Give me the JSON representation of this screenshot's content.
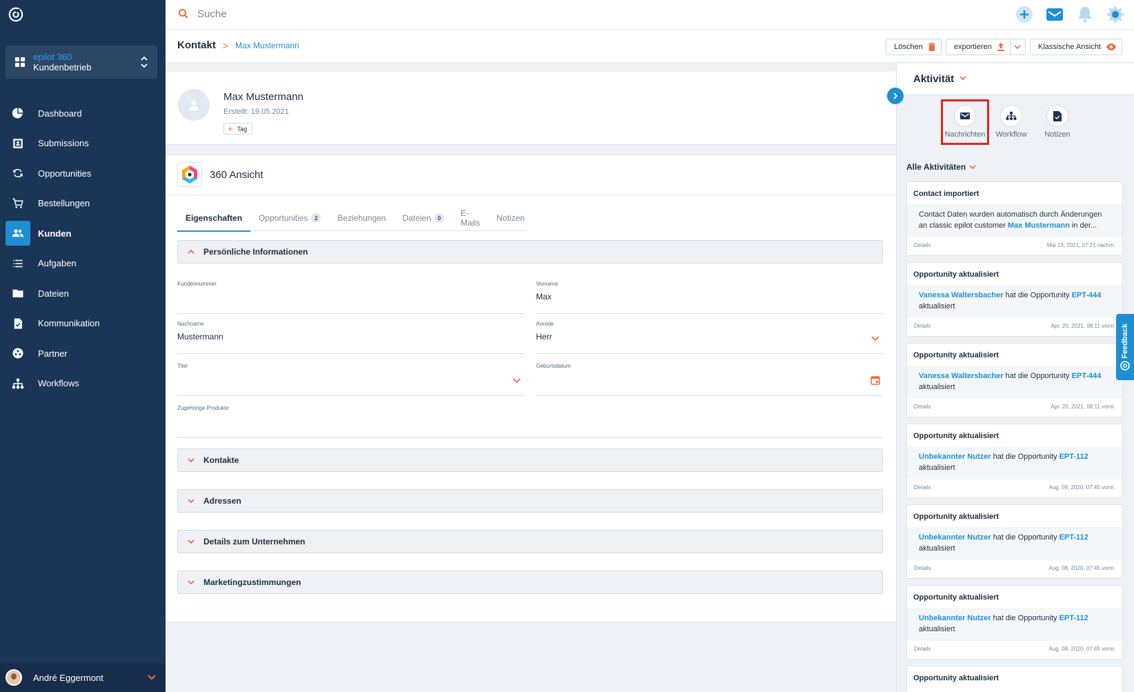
{
  "sidebar": {
    "org_name": "epilot 360",
    "org_sub": "Kundenbetrieb",
    "items": [
      {
        "label": "Dashboard",
        "icon": "dashboard-icon"
      },
      {
        "label": "Submissions",
        "icon": "submissions-icon"
      },
      {
        "label": "Opportunities",
        "icon": "opportunities-icon"
      },
      {
        "label": "Bestellungen",
        "icon": "cart-icon"
      },
      {
        "label": "Kunden",
        "icon": "people-icon",
        "active": true
      },
      {
        "label": "Aufgaben",
        "icon": "list-icon"
      },
      {
        "label": "Dateien",
        "icon": "folder-icon"
      },
      {
        "label": "Kommunikation",
        "icon": "document-check-icon"
      },
      {
        "label": "Partner",
        "icon": "partner-icon"
      },
      {
        "label": "Workflows",
        "icon": "workflow-icon"
      }
    ],
    "user_name": "André Eggermont"
  },
  "topbar": {
    "search_placeholder": "Suche"
  },
  "header": {
    "crumb_root": "Kontakt",
    "crumb_sep": ">",
    "crumb_current": "Max Mustermann",
    "delete_label": "Löschen",
    "export_label": "exportieren",
    "classic_label": "Klassische Ansicht"
  },
  "profile": {
    "name": "Max Mustermann",
    "created": "Erstellt: 19.05.2021",
    "tag_label": "Tag"
  },
  "view": {
    "title": "360 Ansicht",
    "tabs": [
      {
        "label": "Eigenschaften"
      },
      {
        "label": "Opportunities",
        "count": "2"
      },
      {
        "label": "Beziehungen"
      },
      {
        "label": "Dateien",
        "count": "0"
      },
      {
        "label": "E-Mails"
      },
      {
        "label": "Notizen"
      }
    ],
    "sections": {
      "personal": "Persönliche Informationen",
      "contacts": "Kontakte",
      "addresses": "Adressen",
      "company": "Details zum Unternehmen",
      "marketing": "Marketingzustimmungen"
    },
    "fields": {
      "kundennummer": {
        "label": "Kundennummer",
        "value": ""
      },
      "vorname": {
        "label": "Vorname",
        "value": "Max"
      },
      "nachname": {
        "label": "Nachname",
        "value": "Mustermann"
      },
      "anrede": {
        "label": "Anrede",
        "value": "Herr"
      },
      "titel": {
        "label": "Titel",
        "value": ""
      },
      "geburtsdatum": {
        "label": "Geburtsdatum",
        "value": ""
      },
      "produkte": {
        "label": "Zugehörige Produkte",
        "value": ""
      }
    }
  },
  "activity": {
    "title": "Aktivität",
    "tabs": [
      "Nachrichten",
      "Workflow",
      "Notizen"
    ],
    "filter_label": "Alle Aktivitäten",
    "details_label": "Details",
    "cards": [
      {
        "title": "Contact importiert",
        "line1": "Contact Daten wurden automatisch durch Änderungen",
        "line2_pre": "an classic epilot customer ",
        "line2_link": "Max Mustermann",
        "line2_post": " in der...",
        "date": "Mai 19, 2021, 07:21 nachm."
      },
      {
        "title": "Opportunity aktualisiert",
        "user": "Vanessa Waltersbacher",
        "mid": " hat die Opportunity ",
        "ref": "EPT-444",
        "tail": "aktualisiert",
        "date": "Apr. 20, 2021, 08:11 vorm."
      },
      {
        "title": "Opportunity aktualisiert",
        "user": "Vanessa Waltersbacher",
        "mid": " hat die Opportunity ",
        "ref": "EPT-444",
        "tail": "aktualisiert",
        "date": "Apr. 20, 2021, 08:11 vorm."
      },
      {
        "title": "Opportunity aktualisiert",
        "user": "Unbekannter Nutzer",
        "mid": " hat die Opportunity ",
        "ref": "EPT-112",
        "tail": "aktualisiert",
        "date": "Aug. 08, 2020, 07:45 vorm."
      },
      {
        "title": "Opportunity aktualisiert",
        "user": "Unbekannter Nutzer",
        "mid": " hat die Opportunity ",
        "ref": "EPT-112",
        "tail": "aktualisiert",
        "date": "Aug. 08, 2020, 07:45 vorm."
      },
      {
        "title": "Opportunity aktualisiert",
        "user": "Unbekannter Nutzer",
        "mid": " hat die Opportunity ",
        "ref": "EPT-112",
        "tail": "aktualisiert",
        "date": "Aug. 08, 2020, 07:45 vorm."
      },
      {
        "title": "Opportunity aktualisiert"
      }
    ]
  },
  "feedback_label": "Feedback",
  "colors": {
    "sidebar": "#1b3556",
    "accent": "#1e8fd4",
    "orange": "#f26a3d",
    "highlight": "#e1261c"
  }
}
